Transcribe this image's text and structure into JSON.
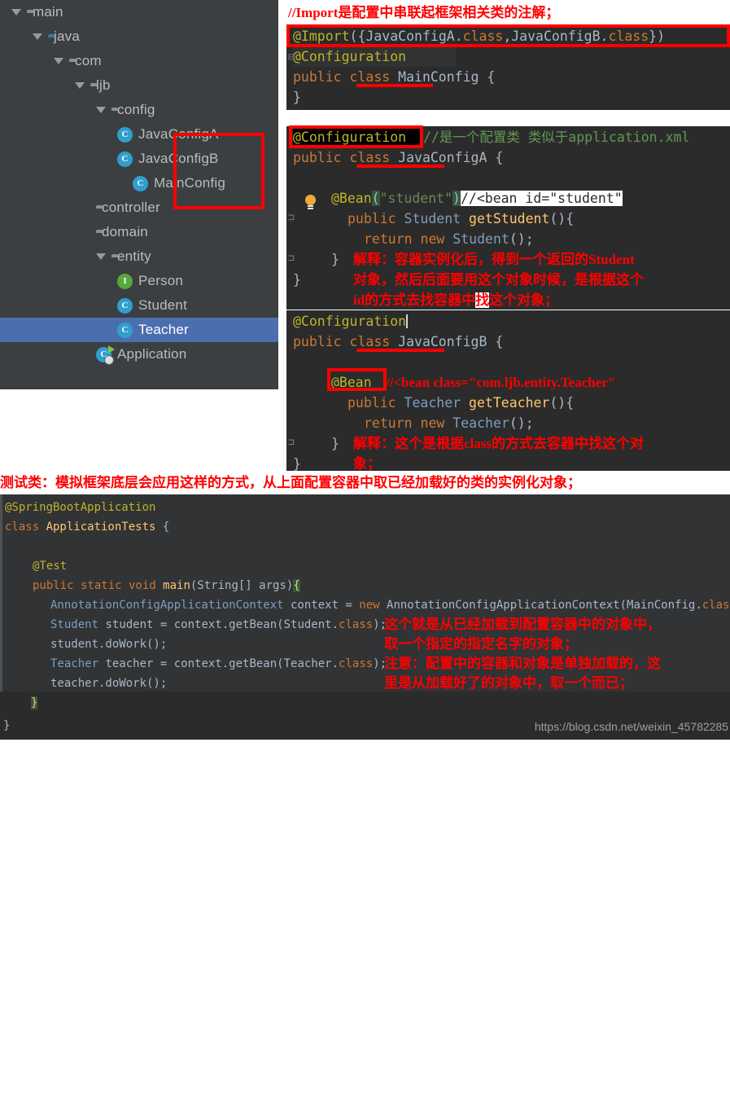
{
  "project_tree": {
    "items": [
      {
        "label": "main",
        "indent": 0,
        "arrow": "down",
        "icon": "folder-grey",
        "selected": false
      },
      {
        "label": "java",
        "indent": 1,
        "arrow": "down",
        "icon": "folder-blue",
        "selected": false
      },
      {
        "label": "com",
        "indent": 2,
        "arrow": "down",
        "icon": "folder-package",
        "selected": false
      },
      {
        "label": "ljb",
        "indent": 3,
        "arrow": "down",
        "icon": "folder-package",
        "selected": false
      },
      {
        "label": "config",
        "indent": 4,
        "arrow": "down",
        "icon": "folder-package",
        "selected": false
      },
      {
        "label": "JavaConfigA",
        "indent": 5,
        "arrow": "right",
        "icon": "class-c",
        "selected": false
      },
      {
        "label": "JavaConfigB",
        "indent": 5,
        "arrow": "right",
        "icon": "class-c",
        "selected": false
      },
      {
        "label": "MainConfig",
        "indent": 5,
        "arrow": "none",
        "icon": "class-c",
        "selected": false
      },
      {
        "label": "controller",
        "indent": 4,
        "arrow": "right",
        "icon": "folder-package",
        "selected": false
      },
      {
        "label": "domain",
        "indent": 4,
        "arrow": "right",
        "icon": "folder-package",
        "selected": false
      },
      {
        "label": "entity",
        "indent": 4,
        "arrow": "down",
        "icon": "folder-package",
        "selected": false
      },
      {
        "label": "Person",
        "indent": 5,
        "arrow": "right",
        "icon": "interface-i",
        "selected": false
      },
      {
        "label": "Student",
        "indent": 5,
        "arrow": "right",
        "icon": "class-c",
        "selected": false
      },
      {
        "label": "Teacher",
        "indent": 5,
        "arrow": "right",
        "icon": "class-c",
        "selected": true
      },
      {
        "label": "Application",
        "indent": 4,
        "arrow": "right",
        "icon": "spring-app",
        "selected": false
      }
    ]
  },
  "annotations": {
    "import_note": "//Import是配置中串联起框架相关类的注解；",
    "config_note": "//是一个配置类 类似于application.xml",
    "bean_student_comment": "//<bean id=\"student\"",
    "explain_student_1": "解释：容器实例化后，得到一个返回的Student",
    "explain_student_2": "对象，然后后面要用这个对象时候，是根据这个",
    "explain_student_3a": "id的方式去找容器中",
    "explain_student_3b": "找",
    "explain_student_3c": "这个对象；",
    "bean_teacher_comment": "//<bean class=\"com.ljb.entity.Teacher\"",
    "explain_teacher_1": "解释：这个是根据class的方式去容器中找这个对",
    "explain_teacher_2": "象；",
    "test_class_note": "测试类：模拟框架底层会应用这样的方式，从上面配置容器中取已经加载好的类的实例化对象；",
    "bottom_note_1": "这个就是从已经加载到配置容器中的对象中，",
    "bottom_note_2": "取一个指定的指定名字的对象；",
    "bottom_note_3": "注意：配置中的容器和对象是单独加载的，这",
    "bottom_note_4": "里是从加载好了的对象中，取一个而已；"
  },
  "code_main_config": {
    "line1_parts": [
      {
        "t": "@Import",
        "c": "ann"
      },
      {
        "t": "({",
        "c": "punc"
      },
      {
        "t": "JavaConfigA",
        "c": "cls-n"
      },
      {
        "t": ".",
        "c": "punc"
      },
      {
        "t": "class",
        "c": "kw"
      },
      {
        "t": ",",
        "c": "punc"
      },
      {
        "t": "JavaConfigB",
        "c": "cls-n"
      },
      {
        "t": ".",
        "c": "punc"
      },
      {
        "t": "class",
        "c": "kw"
      },
      {
        "t": "})",
        "c": "punc"
      }
    ],
    "line2": "@Configuration",
    "line3_kw": "public class ",
    "line3_name": "MainConfig",
    "line3_tail": " {",
    "line4": "}"
  },
  "code_java_config_a": {
    "annotation": "@Configuration",
    "class_kw": "public class ",
    "class_name": "JavaConfigA",
    "class_tail": " {",
    "bean_annotation": "@Bean",
    "bean_arg": "\"student\"",
    "method_kw": "public ",
    "method_type": "Student ",
    "method_name": "getStudent",
    "method_tail": "(){",
    "return_line_kw": "return new ",
    "return_line_type": "Student",
    "return_line_tail": "();",
    "close_method": "}",
    "close_class": "}"
  },
  "code_java_config_b": {
    "annotation": "@Configuration",
    "class_kw": "public class ",
    "class_name": "JavaConfigB",
    "class_tail": " {",
    "bean_annotation": "@Bean",
    "method_kw": "public ",
    "method_type": "Teacher ",
    "method_name": "getTeacher",
    "method_tail": "(){",
    "return_line_kw": "return new ",
    "return_line_type": "Teacher",
    "return_line_tail": "();",
    "close_method": "}",
    "close_class": "}"
  },
  "code_test": {
    "l1": "@SpringBootApplication",
    "l2_kw": "class ",
    "l2_name": "ApplicationTests",
    "l2_tail": " {",
    "l3": "",
    "l4": "@Test",
    "l5_a": "public static void ",
    "l5_b": "main",
    "l5_c": "(String[] args)",
    "l5_d": "{",
    "l6_a": "AnnotationConfigApplicationContext",
    "l6_b": " context = ",
    "l6_c": "new",
    "l6_d": " AnnotationConfigApplicationContext(MainConfig.",
    "l6_e": "class",
    "l6_f": ");",
    "l7_a": "Student",
    "l7_b": " student = context.getBean(Student.",
    "l7_c": "class",
    "l7_d": ");",
    "l8": "student.doWork();",
    "l9_a": "Teacher",
    "l9_b": " teacher = context.getBean(Teacher.",
    "l9_c": "class",
    "l9_d": ");",
    "l10": "teacher.doWork();",
    "l11": "}",
    "l12": "}"
  },
  "watermark": "https://blog.csdn.net/weixin_45782285",
  "colors": {
    "tree_bg": "#3c3f41",
    "tree_selected": "#4b6eaf",
    "editor_bg": "#2b2b2b",
    "editor_bg_alt": "#313335",
    "annotation_red": "#fe0000",
    "keyword_orange": "#cc7832",
    "annotation_yellow": "#bbb529",
    "string_green": "#6a8759",
    "method_gold": "#ffc66d",
    "type_blue": "#7d9ec0",
    "default_fg": "#a9b7c6"
  }
}
